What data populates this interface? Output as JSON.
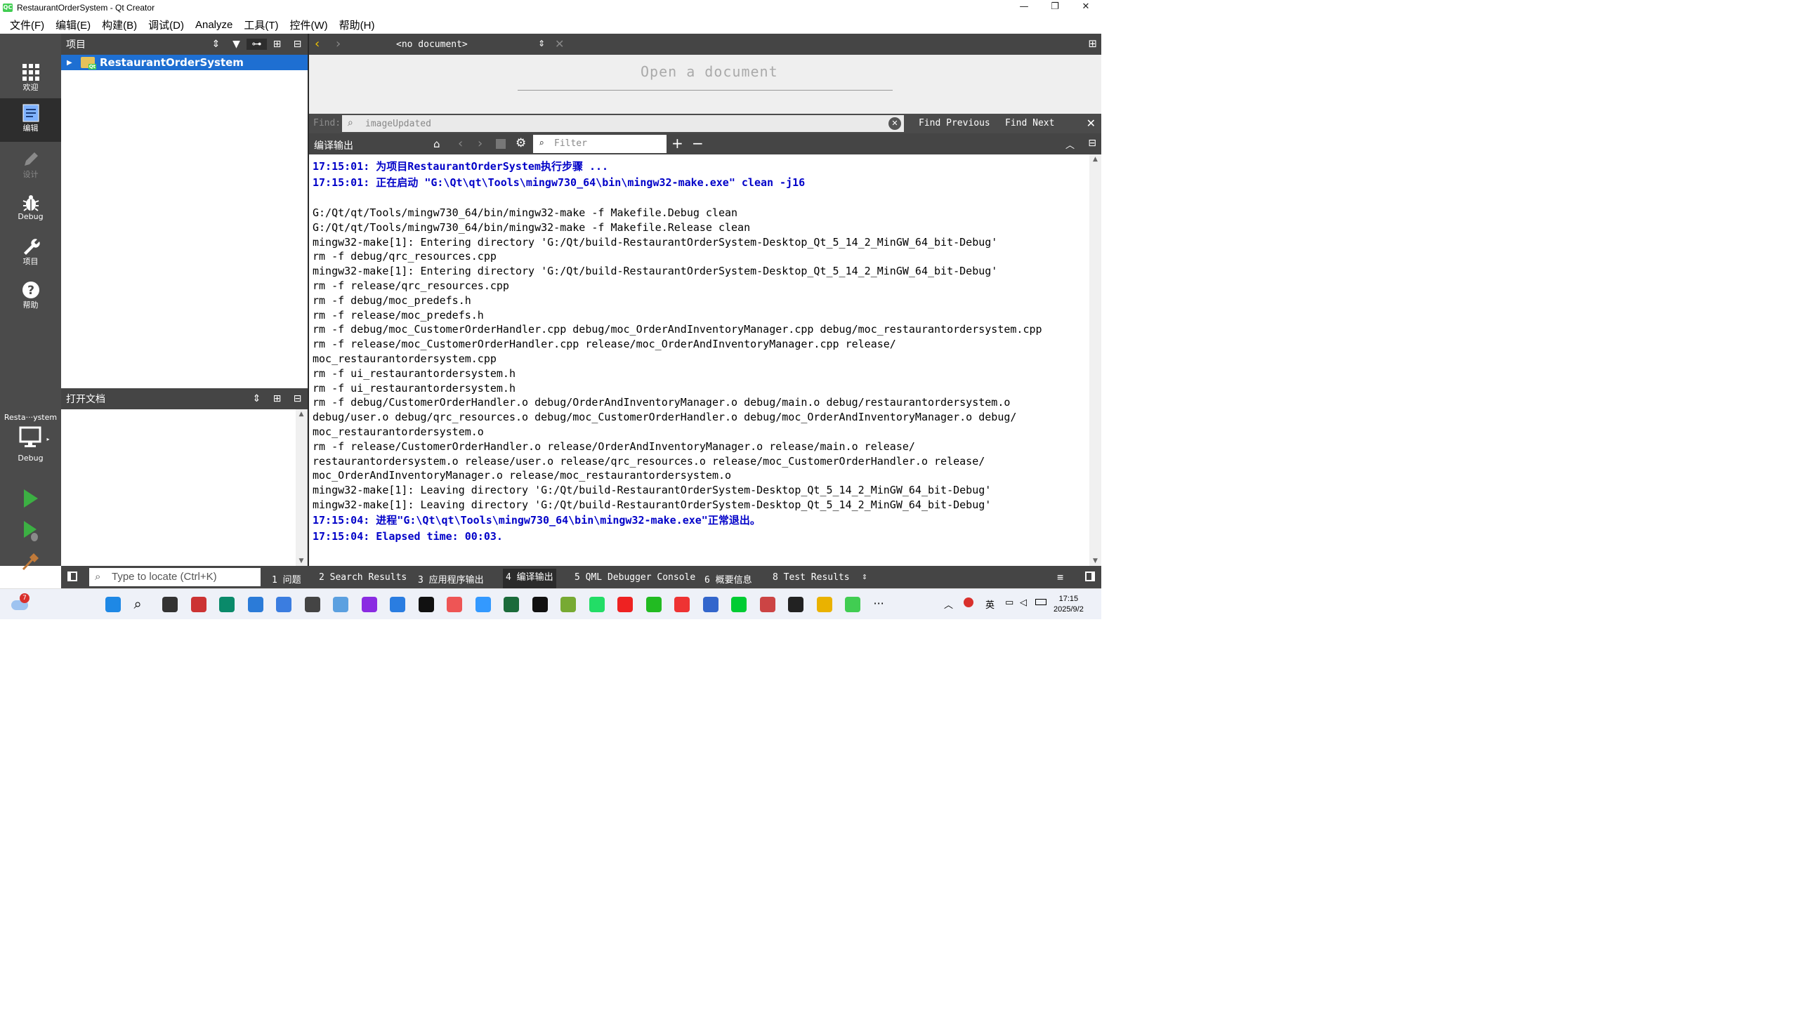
{
  "window": {
    "title": "RestaurantOrderSystem - Qt Creator",
    "controls": [
      "—",
      "❐",
      "✕"
    ]
  },
  "menu": [
    "文件(F)",
    "编辑(E)",
    "构建(B)",
    "调试(D)",
    "Analyze",
    "工具(T)",
    "控件(W)",
    "帮助(H)"
  ],
  "modes": [
    {
      "label": "欢迎",
      "icon": "welcome-grid-icon"
    },
    {
      "label": "编辑",
      "icon": "edit-document-icon",
      "active": true
    },
    {
      "label": "设计",
      "icon": "design-pencil-icon",
      "disabled": true
    },
    {
      "label": "Debug",
      "icon": "debug-bug-icon"
    },
    {
      "label": "项目",
      "icon": "projects-wrench-icon"
    },
    {
      "label": "帮助",
      "icon": "help-question-icon"
    }
  ],
  "kit": {
    "name": "Resta···ystem",
    "config": "Debug"
  },
  "projects": {
    "header": "项目",
    "root": "RestaurantOrderSystem"
  },
  "open_documents": {
    "header": "打开文档"
  },
  "editor": {
    "document_selector": "<no document>",
    "placeholder": "Open a document"
  },
  "find": {
    "label": "Find:",
    "query": "imageUpdated",
    "prev": "Find Previous",
    "next": "Find Next"
  },
  "output": {
    "header": "编译输出",
    "filter_placeholder": "Filter",
    "lines": [
      {
        "t": "17:15:01: 为项目RestaurantOrderSystem执行步骤 ...",
        "c": "blue"
      },
      {
        "t": "17:15:01: 正在启动 \"G:\\Qt\\qt\\Tools\\mingw730_64\\bin\\mingw32-make.exe\" clean -j16",
        "c": "blue"
      },
      {
        "t": "",
        "c": "blank"
      },
      {
        "t": "G:/Qt/qt/Tools/mingw730_64/bin/mingw32-make -f Makefile.Debug clean",
        "c": "ln"
      },
      {
        "t": "G:/Qt/qt/Tools/mingw730_64/bin/mingw32-make -f Makefile.Release clean",
        "c": "ln"
      },
      {
        "t": "mingw32-make[1]: Entering directory 'G:/Qt/build-RestaurantOrderSystem-Desktop_Qt_5_14_2_MinGW_64_bit-Debug'",
        "c": "ln"
      },
      {
        "t": "rm -f debug/qrc_resources.cpp",
        "c": "ln"
      },
      {
        "t": "mingw32-make[1]: Entering directory 'G:/Qt/build-RestaurantOrderSystem-Desktop_Qt_5_14_2_MinGW_64_bit-Debug'",
        "c": "ln"
      },
      {
        "t": "rm -f release/qrc_resources.cpp",
        "c": "ln"
      },
      {
        "t": "rm -f debug/moc_predefs.h",
        "c": "ln"
      },
      {
        "t": "rm -f release/moc_predefs.h",
        "c": "ln"
      },
      {
        "t": "rm -f debug/moc_CustomerOrderHandler.cpp debug/moc_OrderAndInventoryManager.cpp debug/moc_restaurantordersystem.cpp",
        "c": "ln"
      },
      {
        "t": "rm -f release/moc_CustomerOrderHandler.cpp release/moc_OrderAndInventoryManager.cpp release/",
        "c": "ln"
      },
      {
        "t": "moc_restaurantordersystem.cpp",
        "c": "ln"
      },
      {
        "t": "rm -f ui_restaurantordersystem.h",
        "c": "ln"
      },
      {
        "t": "rm -f ui_restaurantordersystem.h",
        "c": "ln"
      },
      {
        "t": "rm -f debug/CustomerOrderHandler.o debug/OrderAndInventoryManager.o debug/main.o debug/restaurantordersystem.o",
        "c": "ln"
      },
      {
        "t": "debug/user.o debug/qrc_resources.o debug/moc_CustomerOrderHandler.o debug/moc_OrderAndInventoryManager.o debug/",
        "c": "ln"
      },
      {
        "t": "moc_restaurantordersystem.o",
        "c": "ln"
      },
      {
        "t": "rm -f release/CustomerOrderHandler.o release/OrderAndInventoryManager.o release/main.o release/",
        "c": "ln"
      },
      {
        "t": "restaurantordersystem.o release/user.o release/qrc_resources.o release/moc_CustomerOrderHandler.o release/",
        "c": "ln"
      },
      {
        "t": "moc_OrderAndInventoryManager.o release/moc_restaurantordersystem.o",
        "c": "ln"
      },
      {
        "t": "mingw32-make[1]: Leaving directory 'G:/Qt/build-RestaurantOrderSystem-Desktop_Qt_5_14_2_MinGW_64_bit-Debug'",
        "c": "ln"
      },
      {
        "t": "mingw32-make[1]: Leaving directory 'G:/Qt/build-RestaurantOrderSystem-Desktop_Qt_5_14_2_MinGW_64_bit-Debug'",
        "c": "ln"
      },
      {
        "t": "17:15:04: 进程\"G:\\Qt\\qt\\Tools\\mingw730_64\\bin\\mingw32-make.exe\"正常退出。",
        "c": "blue"
      },
      {
        "t": "17:15:04: Elapsed time: 00:03.",
        "c": "blue"
      }
    ]
  },
  "statusbar": {
    "locator_placeholder": "Type to locate (Ctrl+K)",
    "tabs": [
      {
        "label": "1 问题"
      },
      {
        "label": "2 Search Results"
      },
      {
        "label": "3 应用程序输出"
      },
      {
        "label": "4 编译输出",
        "active": true
      },
      {
        "label": "5 QML Debugger Console"
      },
      {
        "label": "6 概要信息"
      },
      {
        "label": "8 Test Results"
      }
    ]
  },
  "taskbar": {
    "weather_badge": "7",
    "ime": "英",
    "time": "17:15",
    "date": "2025/9/2",
    "apps": [
      "start-icon",
      "search-icon",
      "task-view-icon",
      "app-icon",
      "edge-icon",
      "vscode-icon",
      "app-icon",
      "app-icon",
      "app-icon",
      "onenote-icon",
      "app-icon",
      "app-icon",
      "app-icon",
      "app-icon",
      "app-icon",
      "capcut-icon",
      "app-icon",
      "app-icon",
      "chrome-like-icon",
      "wechat-icon",
      "wps-icon",
      "notepad-icon",
      "app-icon",
      "app-icon",
      "terminal-icon",
      "explorer-icon",
      "qt-creator-icon",
      "more-icon"
    ]
  },
  "colors": {
    "sidebar": "#4b4b4b",
    "panel_header": "#454545",
    "selection": "#1e6fd2",
    "build_blue": "#0000c8",
    "run_green": "#3cb043"
  }
}
